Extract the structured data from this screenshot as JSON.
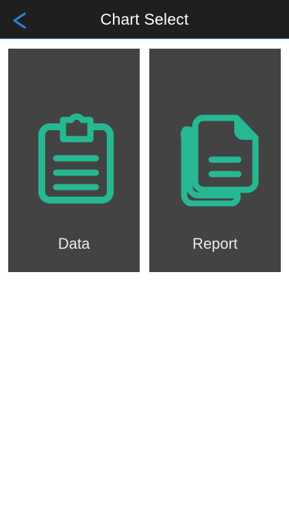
{
  "navbar": {
    "back_label": "<",
    "title": "Chart Select"
  },
  "tiles": [
    {
      "label": "Data",
      "icon": "clipboard-icon"
    },
    {
      "label": "Report",
      "icon": "documents-icon"
    }
  ],
  "colors": {
    "navbar_bg": "#1f1f1f",
    "accent_blue": "#2a7fd4",
    "tile_bg": "#434343",
    "icon_green": "#26b893",
    "label_text": "#ececec"
  }
}
